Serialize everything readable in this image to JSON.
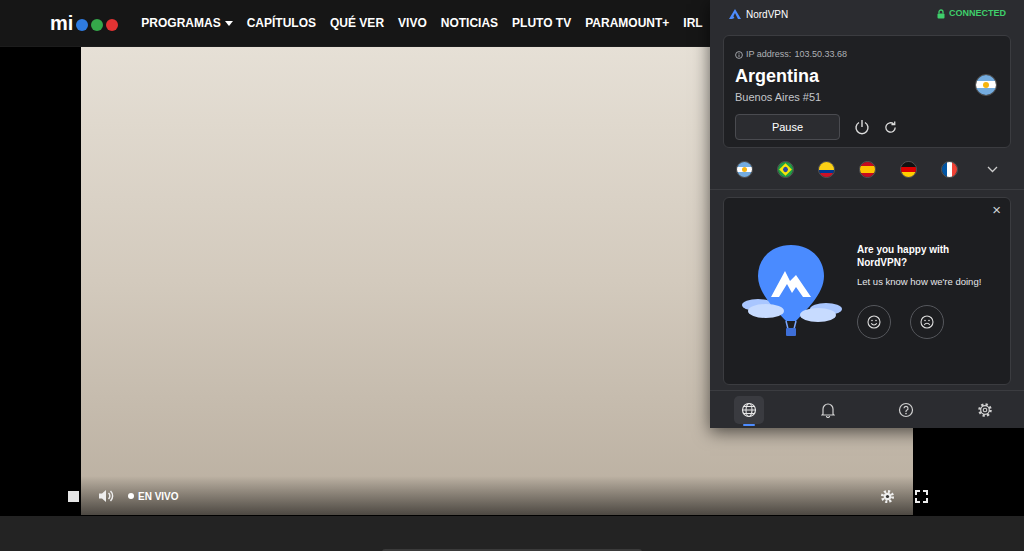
{
  "site": {
    "logo": "mi",
    "nav": [
      {
        "label": "PROGRAMAS",
        "dropdown": true
      },
      {
        "label": "CAPÍTULOS",
        "dropdown": false
      },
      {
        "label": "QUÉ VER",
        "dropdown": false
      },
      {
        "label": "VIVO",
        "dropdown": false
      },
      {
        "label": "NOTICIAS",
        "dropdown": false
      },
      {
        "label": "PLUTO TV",
        "dropdown": false
      },
      {
        "label": "PARAMOUNT+",
        "dropdown": false
      },
      {
        "label": "IRL",
        "dropdown": false
      }
    ]
  },
  "player": {
    "live_label": "EN VIVO",
    "live": true
  },
  "vpn": {
    "app_name": "NordVPN",
    "status": "CONNECTED",
    "connected": true,
    "ip_label": "IP address:",
    "ip": "103.50.33.68",
    "country": "Argentina",
    "server": "Buenos Aires #51",
    "flag_kind": "argentina",
    "pause_label": "Pause",
    "quick_connect": [
      {
        "kind": "argentina"
      },
      {
        "kind": "brazil"
      },
      {
        "kind": "colombia"
      },
      {
        "kind": "spain"
      },
      {
        "kind": "germany"
      },
      {
        "kind": "france"
      }
    ],
    "feedback": {
      "title": "Are you happy with NordVPN?",
      "subtitle": "Let us know how we're doing!",
      "close": "×"
    },
    "bottom_nav": [
      {
        "kind": "globe",
        "selected": true
      },
      {
        "kind": "bell",
        "selected": false
      },
      {
        "kind": "help",
        "selected": false
      },
      {
        "kind": "settings",
        "selected": false
      }
    ]
  }
}
